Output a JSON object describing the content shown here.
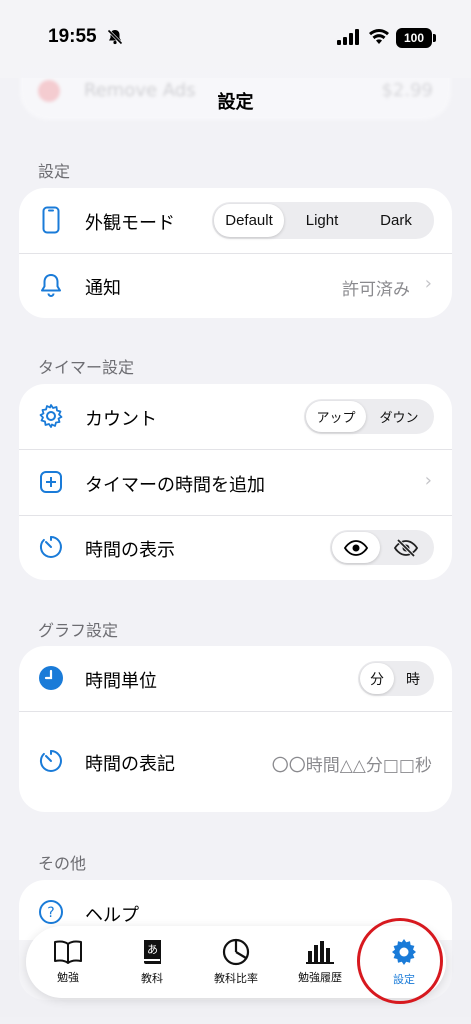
{
  "status_bar": {
    "time": "19:55",
    "battery": "100"
  },
  "background_row": {
    "label": "Remove Ads",
    "price": "$2.99"
  },
  "nav": {
    "title": "設定"
  },
  "sections": {
    "settings": {
      "header": "設定",
      "appearance": {
        "label": "外観モード",
        "options": [
          "Default",
          "Light",
          "Dark"
        ],
        "selected": "Default"
      },
      "notifications": {
        "label": "通知",
        "value": "許可済み"
      }
    },
    "timer": {
      "header": "タイマー設定",
      "count": {
        "label": "カウント",
        "options": [
          "アップ",
          "ダウン"
        ],
        "selected": "アップ"
      },
      "add_time": {
        "label": "タイマーの時間を追加"
      },
      "time_display": {
        "label": "時間の表示"
      }
    },
    "graph": {
      "header": "グラフ設定",
      "time_unit": {
        "label": "時間単位",
        "options": [
          "分",
          "時"
        ],
        "selected": "分"
      },
      "time_format": {
        "label": "時間の表記",
        "value": "〇〇時間△△分□□秒"
      }
    },
    "other": {
      "header": "その他",
      "help": {
        "label": "ヘルプ"
      }
    }
  },
  "tab_bar": {
    "tabs": [
      {
        "label": "勉強",
        "icon": "book-icon"
      },
      {
        "label": "教科",
        "icon": "dictionary-icon"
      },
      {
        "label": "教科比率",
        "icon": "pie-chart-icon"
      },
      {
        "label": "勉強履歴",
        "icon": "bar-chart-icon"
      },
      {
        "label": "設定",
        "icon": "gear-icon",
        "active": true
      }
    ]
  },
  "colors": {
    "accent": "#1a7bd8",
    "highlight_circle": "#d7191f"
  }
}
